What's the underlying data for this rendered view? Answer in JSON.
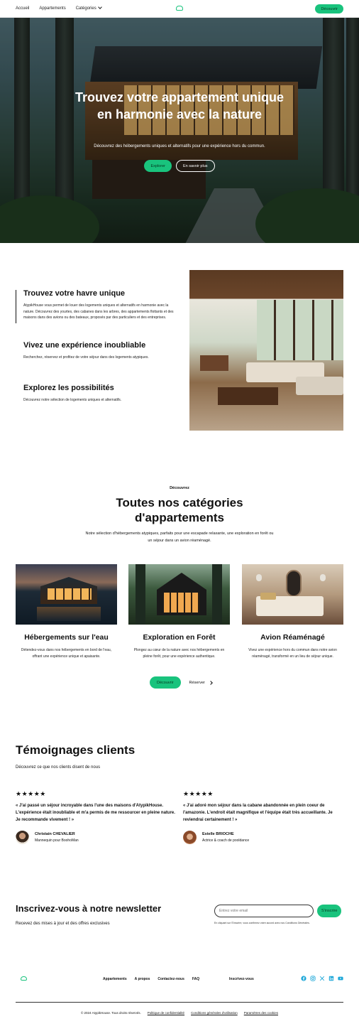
{
  "nav": {
    "links": [
      "Accueil",
      "Appartements",
      "Catégories"
    ],
    "cta": "Découvrir"
  },
  "hero": {
    "title": "Trouvez votre appartement unique en harmonie avec la nature",
    "subtitle": "Découvrez des hébergements uniques et alternatifs pour une expérience hors du commun.",
    "primary_button": "Explorer",
    "secondary_button": "En savoir plus"
  },
  "features": [
    {
      "title": "Trouvez votre havre unique",
      "text": "AtypikHouse vous permet de louer des logements uniques et alternatifs en harmonie avec la nature. Découvrez des yourtes, des cabanes dans les arbres, des appartements flottants et des maisons dans des avions ou des bateaux, proposés par des particuliers et des entreprises."
    },
    {
      "title": "Vivez une expérience inoubliable",
      "text": "Recherchez, réservez et profitez de votre séjour dans des logements atypiques."
    },
    {
      "title": "Explorez les possibilités",
      "text": "Découvrez notre sélection de logements uniques et alternatifs."
    }
  ],
  "categories": {
    "eyebrow": "Découvrez",
    "title": "Toutes nos catégories d'appartements",
    "subtitle": "Notre sélection d'hébergements atypiques, parfaits pour une escapade relaxante, une exploration en forêt ou un séjour dans un avion réaménagé.",
    "items": [
      {
        "title": "Hébergements sur l'eau",
        "text": "Détendez-vous dans nos hébergements en bord de l'eau, offrant une expérience unique et apaisante."
      },
      {
        "title": "Exploration en Forêt",
        "text": "Plongez au cœur de la nature avec nos hébergements en pleine forêt, pour une expérience authentique."
      },
      {
        "title": "Avion Réaménagé",
        "text": "Vivez une expérience hors du commun dans notre avion réaménagé, transformé en un lieu de séjour unique."
      }
    ],
    "primary_button": "Découvrir",
    "secondary_link": "Réserver"
  },
  "testimonials": {
    "title": "Témoignages clients",
    "subtitle": "Découvrez ce que nos clients disent de nous",
    "rating": 5,
    "items": [
      {
        "stars": "★★★★★",
        "quote": "« J'ai passé un séjour incroyable dans l'une des maisons d'AtypikHouse. L'expérience était inoubliable et m'a permis de me ressourcer en pleine nature. Je recommande vivement ! »",
        "name": "Christain CHEVALIER",
        "role": "Mannequin pour BoohoMan"
      },
      {
        "stars": "★★★★★",
        "quote": "« J'ai adoré mon séjour dans la cabane abandonnée en plein coeur de l'amazonie. L'endroit était magnifique et l'équipe était très accueillante. Je reviendrai certainement ! »",
        "name": "Estelle BRIOCHE",
        "role": "Actrice & coach de pooldance"
      }
    ]
  },
  "newsletter": {
    "title": "Inscrivez-vous à notre newsletter",
    "subtitle": "Recevez des mises à jour et des offres exclusives",
    "placeholder": "Entrez votre email",
    "button": "S'inscrire",
    "note": "En cliquant sur S'inscrire, vous confirmez votre accord avec nos Conditions Générales."
  },
  "footer": {
    "links": [
      "Appartements",
      "A propos",
      "Contactez-nous",
      "FAQ"
    ],
    "subscribe": "Inscrivez-vous",
    "socials": [
      "facebook-icon",
      "instagram-icon",
      "x-icon",
      "linkedin-icon",
      "youtube-icon"
    ],
    "copyright": "© 2024 AtypikHouse. Tous droits réservés.",
    "legal": [
      "Politique de confidentialité",
      "Conditions générales d'utilisation",
      "Paramètres des cookies"
    ]
  },
  "colors": {
    "accent": "#19c37d",
    "social": "#1aa6d8"
  }
}
